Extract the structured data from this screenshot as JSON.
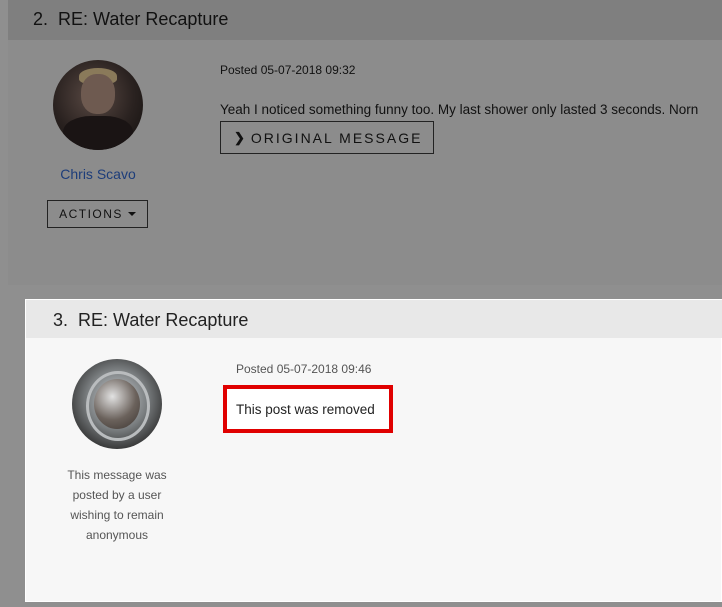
{
  "post2": {
    "number": "2.",
    "title": "RE: Water Recapture",
    "author": "Chris Scavo",
    "actions_label": "ACTIONS",
    "posted": "Posted 05-07-2018 09:32",
    "body": "Yeah I noticed something funny too.  My last shower only lasted 3 seconds.  Norn",
    "original_message_label": "ORIGINAL MESSAGE"
  },
  "post3": {
    "number": "3.",
    "title": "RE: Water Recapture",
    "anon_text": "This message was posted by a user wishing to remain anonymous",
    "posted": "Posted 05-07-2018 09:46",
    "body": "This post was removed"
  },
  "colors": {
    "highlight_border": "#e00000",
    "author_link": "#1d3d7a"
  },
  "icons": {
    "original_message": "chevron-right-icon",
    "actions": "caret-down-icon"
  }
}
